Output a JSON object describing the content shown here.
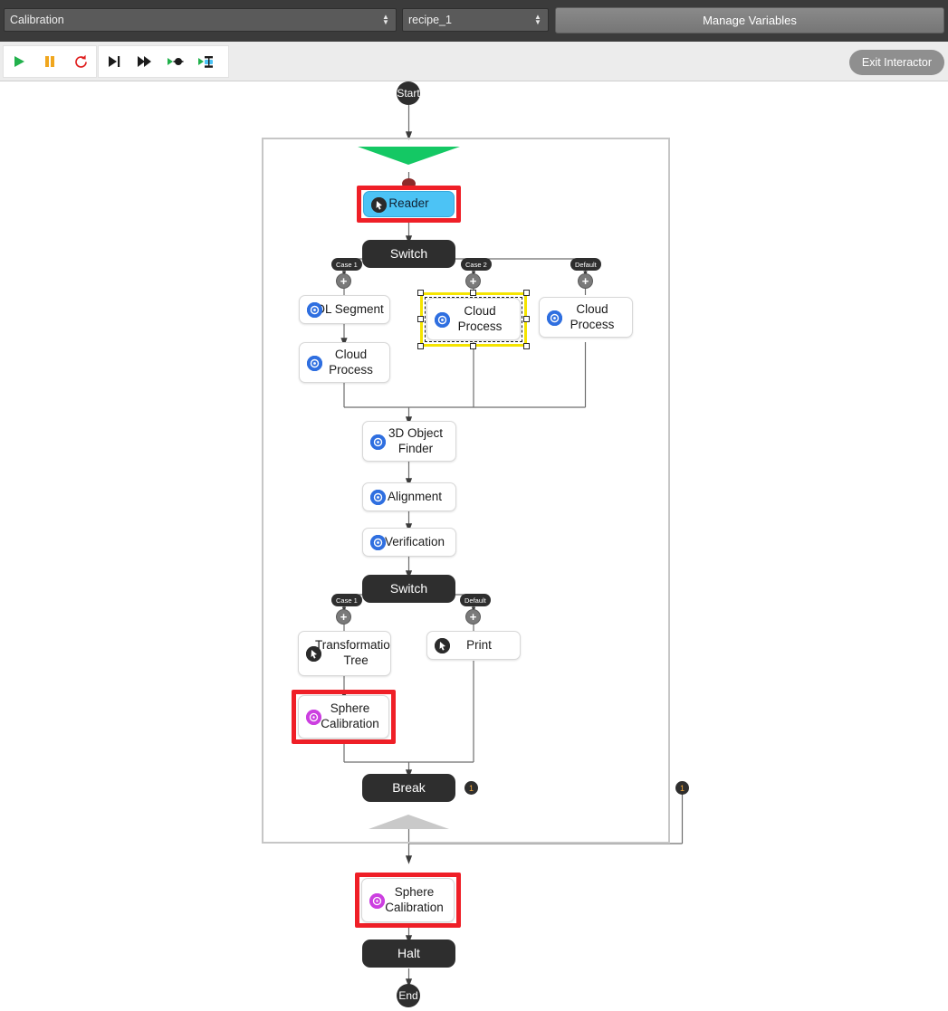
{
  "topbar": {
    "program_select": {
      "value": "Calibration",
      "arrow": "updown-arrow-icon"
    },
    "recipe_select": {
      "value": "recipe_1",
      "arrow": "updown-arrow-icon"
    },
    "manage_variables_label": "Manage Variables"
  },
  "toolbar": {
    "buttons": [
      {
        "name": "run-button",
        "icon": "play-icon",
        "color": "#22b14c"
      },
      {
        "name": "pause-button",
        "icon": "pause-icon",
        "color": "#f0a61e"
      },
      {
        "name": "reset-button",
        "icon": "reload-icon",
        "color": "#e02020"
      },
      {
        "name": "step-over-button",
        "icon": "step-over-icon",
        "color": "#1b1b1b"
      },
      {
        "name": "step-forward-button",
        "icon": "step-forward-icon",
        "color": "#1b1b1b"
      },
      {
        "name": "run-to-node-button",
        "icon": "run-to-node-icon",
        "color": "#1b1b1b"
      },
      {
        "name": "run-to-breakpoint-button",
        "icon": "run-to-breakpoint-icon",
        "color": "#1b1b1b"
      }
    ],
    "exit_interactor_label": "Exit Interactor"
  },
  "flowchart": {
    "start_label": "Start",
    "end_label": "End",
    "nodes": [
      {
        "id": "reader",
        "label": "Reader",
        "icon": "cursor-icon",
        "style": "blue",
        "selection": "red"
      },
      {
        "id": "switch-1",
        "label": "Switch",
        "icon": "none",
        "style": "dark",
        "selection": "none"
      },
      {
        "id": "dl-segment",
        "label": "DL Segment",
        "icon": "vision-icon",
        "style": "white",
        "selection": "none"
      },
      {
        "id": "cloud-proc-1",
        "label": "Cloud Process",
        "icon": "vision-icon",
        "style": "white",
        "selection": "none"
      },
      {
        "id": "cloud-proc-2",
        "label": "Cloud Process",
        "icon": "vision-icon",
        "style": "white",
        "selection": "yellow"
      },
      {
        "id": "cloud-proc-3",
        "label": "Cloud Process",
        "icon": "vision-icon",
        "style": "white",
        "selection": "none"
      },
      {
        "id": "obj-finder",
        "label": "3D Object Finder",
        "icon": "vision-icon",
        "style": "white",
        "selection": "none"
      },
      {
        "id": "alignment",
        "label": "Alignment",
        "icon": "vision-icon",
        "style": "white",
        "selection": "none"
      },
      {
        "id": "verification",
        "label": "Verification",
        "icon": "vision-icon",
        "style": "white",
        "selection": "none"
      },
      {
        "id": "switch-2",
        "label": "Switch",
        "icon": "none",
        "style": "dark",
        "selection": "none"
      },
      {
        "id": "transform-tree",
        "label": "Transformation Tree",
        "icon": "cursor-icon",
        "style": "white",
        "selection": "none"
      },
      {
        "id": "print",
        "label": "Print",
        "icon": "cursor-icon",
        "style": "white",
        "selection": "none"
      },
      {
        "id": "sphere-cal-1",
        "label": "Sphere Calibration",
        "icon": "calibrate-icon",
        "style": "white",
        "selection": "red"
      },
      {
        "id": "break",
        "label": "Break",
        "icon": "none",
        "style": "dark",
        "selection": "none"
      },
      {
        "id": "sphere-cal-2",
        "label": "Sphere Calibration",
        "icon": "calibrate-icon",
        "style": "white",
        "selection": "red"
      },
      {
        "id": "halt",
        "label": "Halt",
        "icon": "none",
        "style": "dark",
        "selection": "none"
      }
    ],
    "switch1_cases": [
      {
        "label": "Case 1"
      },
      {
        "label": "Case 2"
      },
      {
        "label": "Default"
      }
    ],
    "switch2_cases": [
      {
        "label": "Case 1"
      },
      {
        "label": "Default"
      }
    ],
    "badges": [
      {
        "name": "break-badge",
        "value": "1"
      },
      {
        "name": "loop-exit-badge",
        "value": "1"
      }
    ],
    "plus_label": "+"
  },
  "colors": {
    "accent_blue": "#4cc3f5",
    "selection_red": "#ef1f27",
    "selection_yellow": "#f5e400",
    "loop_in_arrow": "#14c864",
    "loop_out_arrow": "#c9c9c9",
    "node_dark": "#2e2e2e",
    "icon_blue": "#2f6fe0",
    "icon_purple": "#cc3fe0",
    "topbar_bg": "#3b3b3b"
  }
}
